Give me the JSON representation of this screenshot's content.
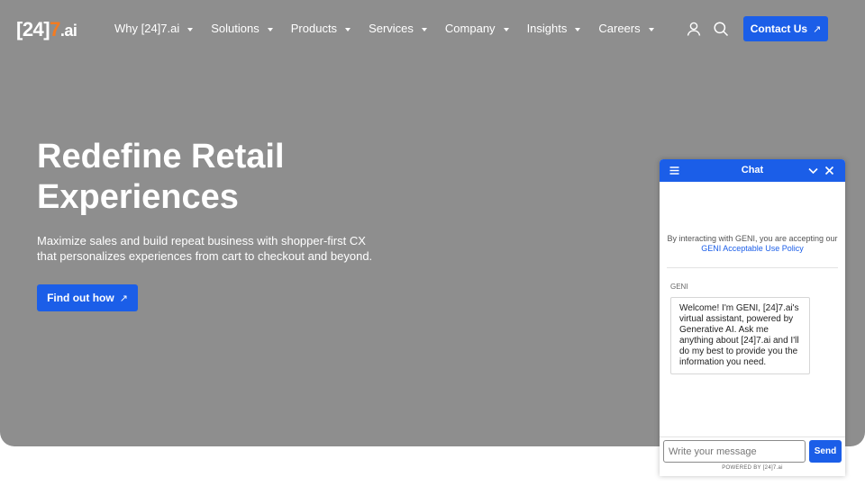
{
  "brand": {
    "logo_open": "[24]",
    "logo_seven": "7",
    "logo_ai": ".ai",
    "accent_color": "#1b5ee8",
    "logo_accent_color": "#f47b20",
    "hero_bg": "#8e8e8e"
  },
  "nav": {
    "items": [
      {
        "label": "Why [24]7.ai"
      },
      {
        "label": "Solutions"
      },
      {
        "label": "Products"
      },
      {
        "label": "Services"
      },
      {
        "label": "Company"
      },
      {
        "label": "Insights"
      },
      {
        "label": "Careers"
      }
    ],
    "icons": [
      "user-icon",
      "search-icon"
    ],
    "contact_label": "Contact Us",
    "contact_icon": "arrow-up-right-icon"
  },
  "hero": {
    "title": "Redefine Retail Experiences",
    "subtitle": "Maximize sales and build repeat business with shopper-first CX that personalizes experiences from cart to checkout and beyond.",
    "cta_label": "Find out how",
    "cta_icon": "arrow-up-right-icon"
  },
  "chat": {
    "title": "Chat",
    "header_icons": [
      "menu-icon",
      "chevron-down-icon",
      "close-icon"
    ],
    "consent_text": "By interacting with GENI, you are accepting our",
    "consent_link": "GENI Acceptable Use Policy",
    "sender": "GENI",
    "message": "Welcome! I'm GENI, [24]7.ai's virtual assistant, powered by Generative AI. Ask me anything about [24]7.ai and I'll do my best to provide you the information you need.",
    "input_placeholder": "Write your message",
    "send_label": "Send",
    "powered_by": "POWERED BY [24]7.ai"
  }
}
